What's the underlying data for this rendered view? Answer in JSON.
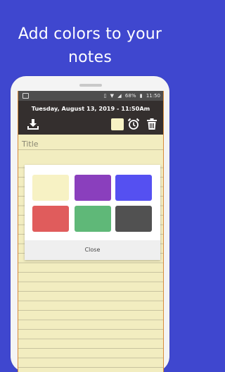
{
  "promo": {
    "headline": "Add colors to your notes"
  },
  "status_bar": {
    "battery": "68%",
    "time": "11:50"
  },
  "toolbar": {
    "date_text": "Tuesday, August 13, 2019 - 11:50Am",
    "icons": [
      "download-icon",
      "color-picker-swatch",
      "alarm-clock-icon",
      "trash-icon"
    ]
  },
  "note": {
    "title_placeholder": "Title"
  },
  "color_dialog": {
    "colors": [
      "#f7f2c4",
      "#8a3fbd",
      "#5550f1",
      "#e05c5c",
      "#5fb878",
      "#515151"
    ],
    "close_label": "Close"
  },
  "colors": {
    "background": "#3f47cf",
    "toolbar": "#342f2e",
    "paper": "#f7f2c4"
  }
}
